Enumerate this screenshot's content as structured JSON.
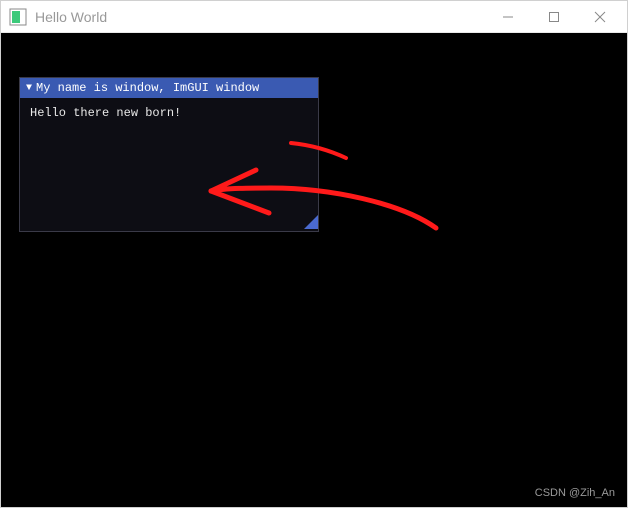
{
  "window": {
    "title": "Hello World"
  },
  "imgui": {
    "title": "My name is window, ImGUI window",
    "content": "Hello there new born!"
  },
  "watermark": "CSDN @Zih_An"
}
